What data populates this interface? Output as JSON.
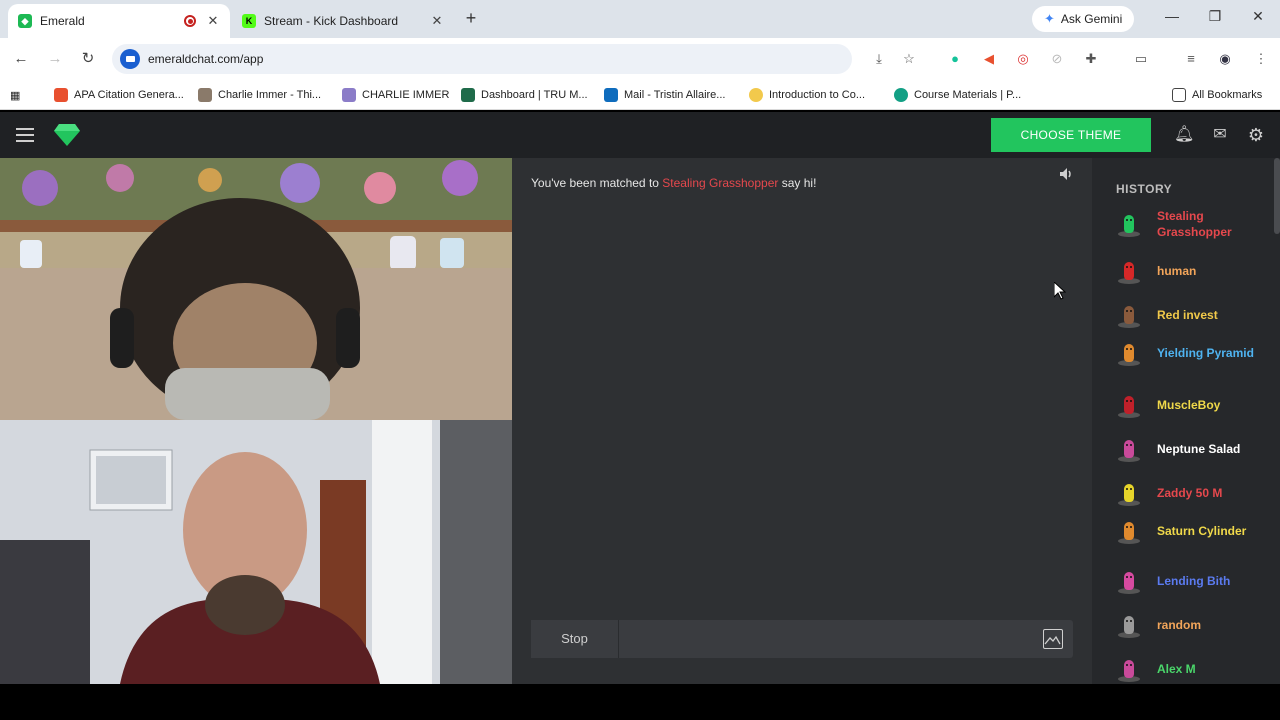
{
  "browser": {
    "tabs": [
      {
        "label": "Emerald",
        "active": true,
        "recording": true,
        "favicon_color": "#1db954"
      },
      {
        "label": "Stream - Kick Dashboard",
        "active": false,
        "favicon_color": "#53fc18"
      }
    ],
    "ask_gemini": "Ask Gemini",
    "url": "emeraldchat.com/app",
    "bookmarks": [
      {
        "label": "APA Citation Genera...",
        "color": "#e8502f"
      },
      {
        "label": "Charlie Immer - Thi...",
        "color": "#8a7a6a"
      },
      {
        "label": "CHARLIE IMMER",
        "color": "#8b7cc8"
      },
      {
        "label": "Dashboard | TRU M...",
        "color": "#1f6b4a"
      },
      {
        "label": "Mail - Tristin Allaire...",
        "color": "#0f6cbd"
      },
      {
        "label": "Introduction to Co...",
        "color": "#f2c94c"
      },
      {
        "label": "Course Materials | P...",
        "color": "#13a085"
      }
    ],
    "all_bookmarks": "All Bookmarks"
  },
  "app": {
    "choose_theme": "CHOOSE THEME",
    "accent": "#22c55e",
    "chat": {
      "match_prefix": "You've been matched to",
      "match_name": "Stealing Grasshopper",
      "match_suffix": "say hi!",
      "stop_label": "Stop",
      "input_placeholder": ""
    },
    "history": {
      "title": "HISTORY",
      "items": [
        {
          "name": "Stealing Grasshopper",
          "color": "#e5484d",
          "avatar": "#22c55e"
        },
        {
          "name": "human",
          "color": "#f2a55a",
          "avatar": "#d62828"
        },
        {
          "name": "Red invest",
          "color": "#f0c94a",
          "avatar": "#8a5a3c"
        },
        {
          "name": "Yielding Pyramid",
          "color": "#4fb3f0",
          "avatar": "#e08a2e"
        },
        {
          "name": "MuscleBoy",
          "color": "#f0d94a",
          "avatar": "#c0202a"
        },
        {
          "name": "Neptune Salad",
          "color": "#ffffff",
          "avatar": "#c94a9a"
        },
        {
          "name": "Zaddy 50 M",
          "color": "#e5484d",
          "avatar": "#e6d42a"
        },
        {
          "name": "Saturn Cylinder",
          "color": "#f0d94a",
          "avatar": "#e08a2e"
        },
        {
          "name": "Lending Bith",
          "color": "#5b7bf0",
          "avatar": "#d64aa0"
        },
        {
          "name": "random",
          "color": "#f2a55a",
          "avatar": "#9a9a9a"
        },
        {
          "name": "Alex M",
          "color": "#4ad66a",
          "avatar": "#c94a9a"
        }
      ]
    }
  }
}
